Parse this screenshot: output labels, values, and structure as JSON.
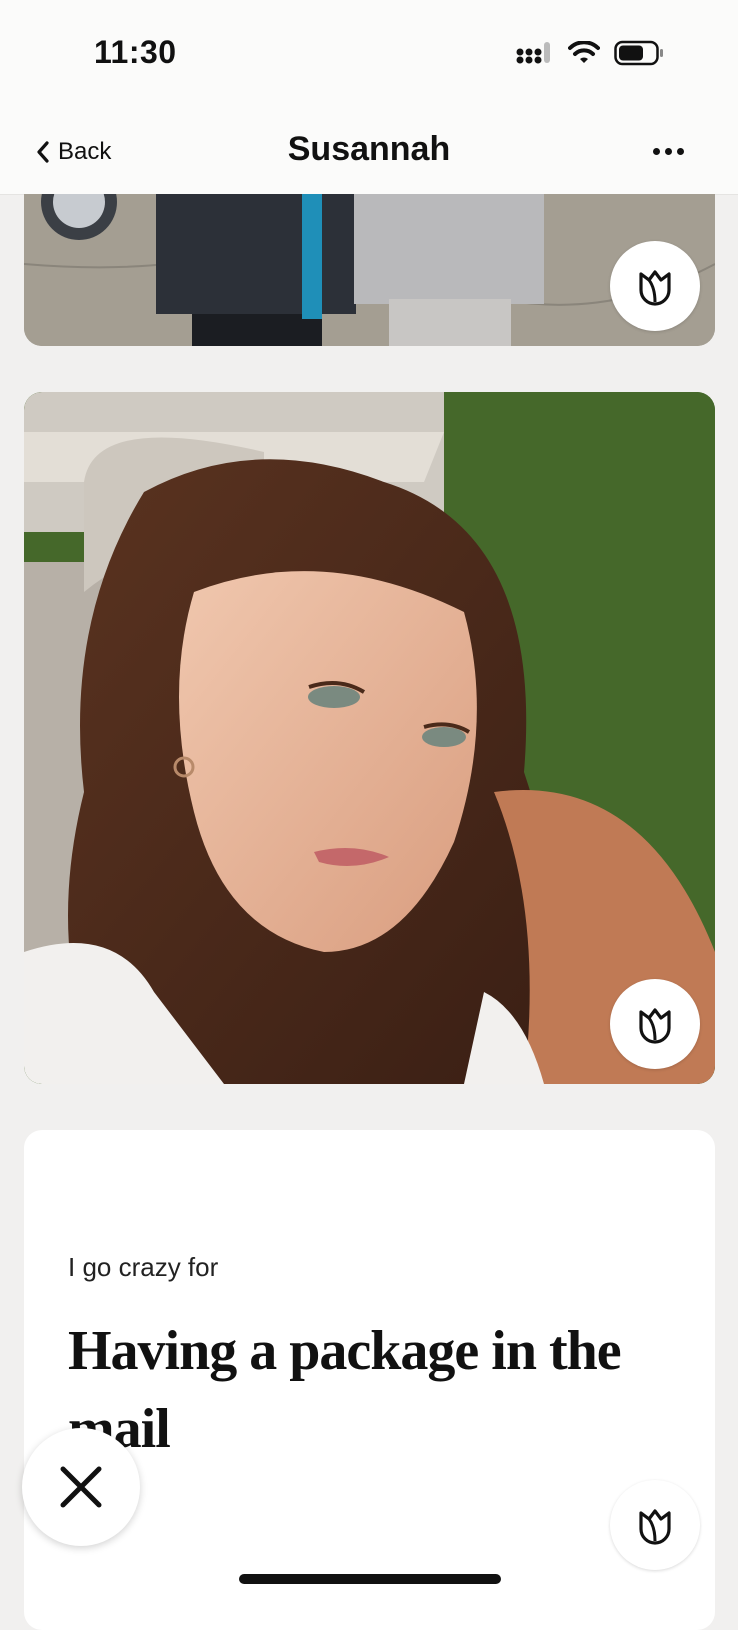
{
  "status_bar": {
    "time": "11:30",
    "icons": [
      "signal-icon",
      "wifi-icon",
      "battery-icon"
    ]
  },
  "nav": {
    "back_label": "Back",
    "title": "Susannah",
    "more_icon": "more-icon"
  },
  "photos": [
    {
      "name": "profile-photo-1",
      "like_icon": "rose-icon"
    },
    {
      "name": "profile-photo-2",
      "like_icon": "rose-icon"
    }
  ],
  "prompt": {
    "label": "I go crazy for",
    "answer": "Having a package in the mail",
    "like_icon": "rose-icon"
  },
  "actions": {
    "dismiss_icon": "close-icon"
  },
  "colors": {
    "background": "#f1f0ef",
    "card": "#ffffff",
    "text": "#111111"
  }
}
